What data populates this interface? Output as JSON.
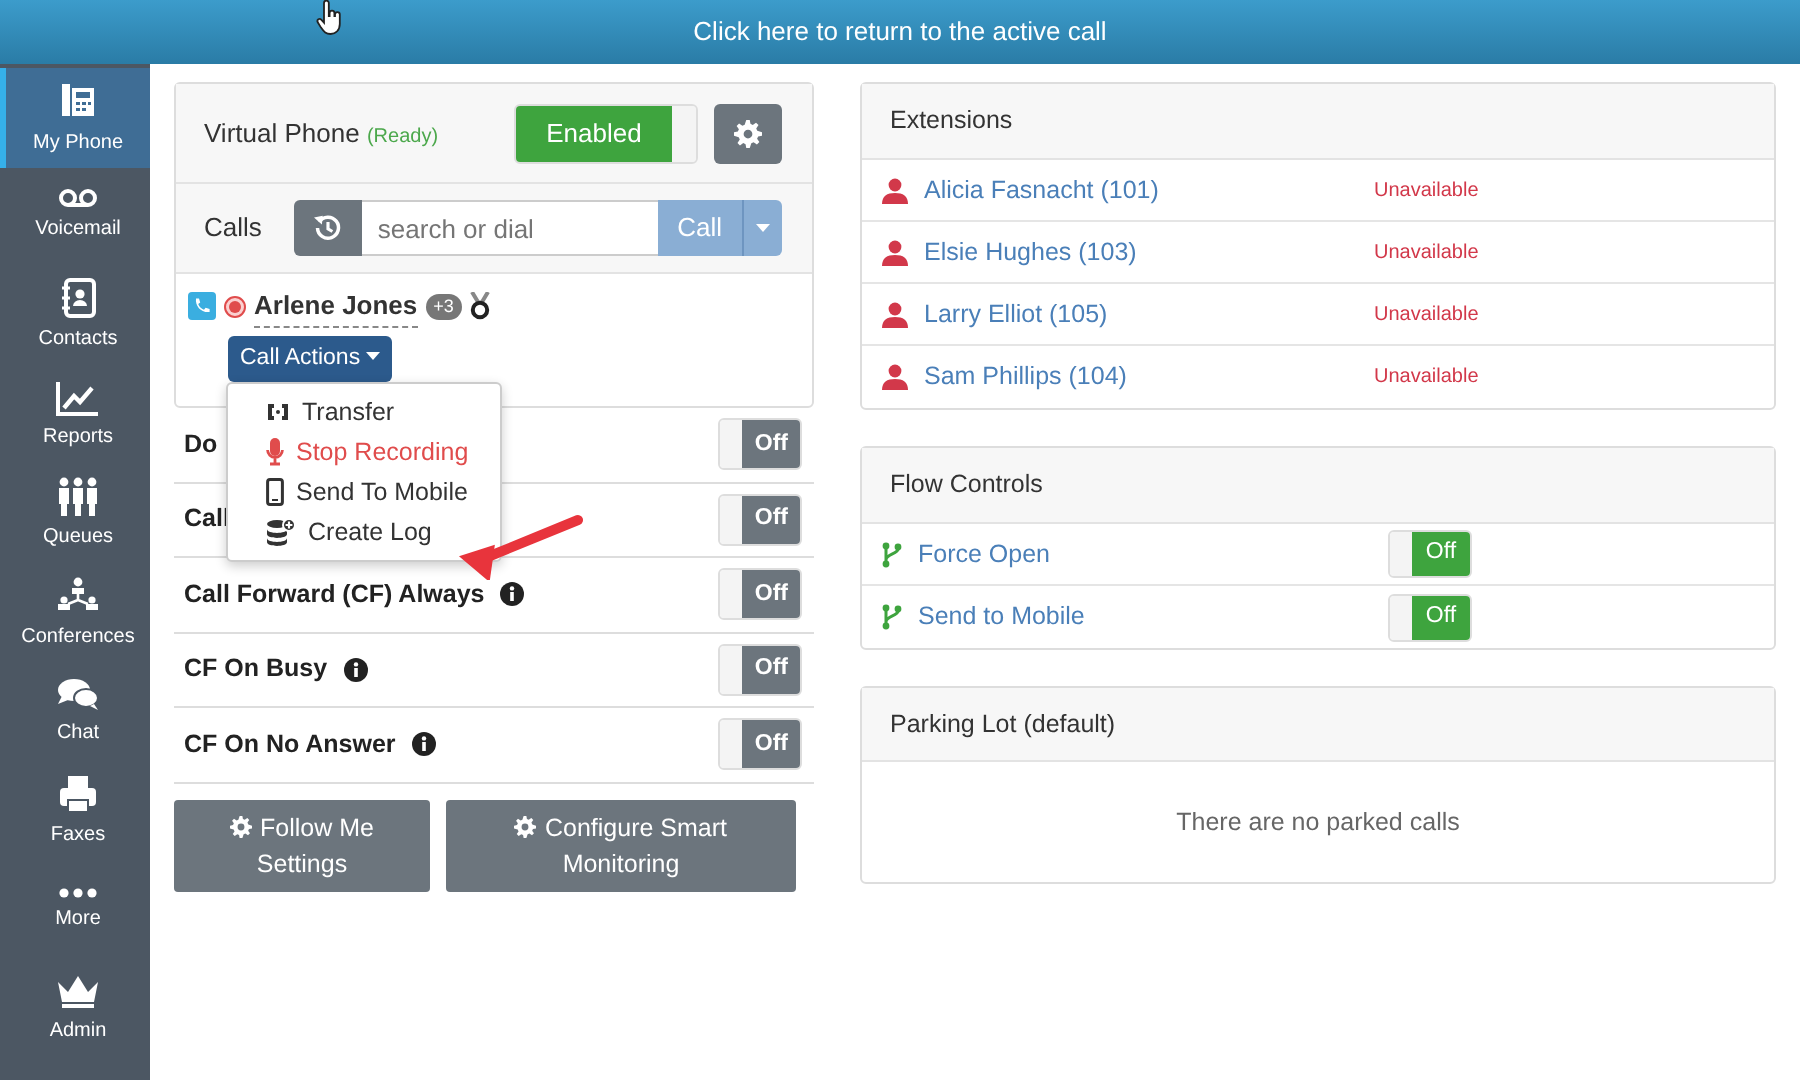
{
  "banner": {
    "text": "Click here to return to the active call"
  },
  "sidebar": {
    "items": [
      {
        "label": "My Phone",
        "selected": true
      },
      {
        "label": "Voicemail",
        "selected": false
      },
      {
        "label": "Contacts",
        "selected": false
      },
      {
        "label": "Reports",
        "selected": false
      },
      {
        "label": "Queues",
        "selected": false
      },
      {
        "label": "Conferences",
        "selected": false
      },
      {
        "label": "Chat",
        "selected": false
      },
      {
        "label": "Faxes",
        "selected": false
      },
      {
        "label": "More",
        "selected": false
      },
      {
        "label": "Admin",
        "selected": false
      }
    ]
  },
  "virtual_phone": {
    "label": "Virtual Phone",
    "status": "(Ready)",
    "toggle": {
      "label": "Enabled",
      "on": true
    }
  },
  "calls": {
    "label": "Calls",
    "search": {
      "placeholder": "search or dial"
    },
    "call_button": {
      "label": "Call",
      "disabled": true
    }
  },
  "active_call": {
    "name": "Arlene Jones",
    "badge": "+3",
    "recording": true,
    "actions_button": "Call Actions"
  },
  "call_actions_menu": [
    {
      "label": "Transfer",
      "kind": "normal"
    },
    {
      "label": "Stop Recording",
      "kind": "danger"
    },
    {
      "label": "Send To Mobile",
      "kind": "normal"
    },
    {
      "label": "Create Log",
      "kind": "normal"
    }
  ],
  "settings": [
    {
      "label": "Do",
      "info": false,
      "toggle": {
        "label": "Off"
      }
    },
    {
      "label": "Call",
      "info": false,
      "toggle": {
        "label": "Off"
      }
    },
    {
      "label": "Call Forward (CF) Always",
      "info": true,
      "toggle": {
        "label": "Off"
      }
    },
    {
      "label": "CF On Busy",
      "info": true,
      "toggle": {
        "label": "Off"
      }
    },
    {
      "label": "CF On No Answer",
      "info": true,
      "toggle": {
        "label": "Off"
      }
    }
  ],
  "buttons": [
    "Follow Me Settings",
    "Configure Smart Monitoring"
  ],
  "extensions": {
    "title": "Extensions",
    "rows": [
      {
        "name": "Alicia Fasnacht (101)",
        "status": "Unavailable"
      },
      {
        "name": "Elsie Hughes (103)",
        "status": "Unavailable"
      },
      {
        "name": "Larry Elliot (105)",
        "status": "Unavailable"
      },
      {
        "name": "Sam Phillips (104)",
        "status": "Unavailable"
      }
    ]
  },
  "flow_controls": {
    "title": "Flow Controls",
    "rows": [
      {
        "label": "Force Open",
        "toggle": {
          "label": "Off"
        }
      },
      {
        "label": "Send to Mobile",
        "toggle": {
          "label": "Off"
        }
      }
    ]
  },
  "parking_lot": {
    "title": "Parking Lot (default)",
    "empty_text": "There are no parked calls"
  }
}
